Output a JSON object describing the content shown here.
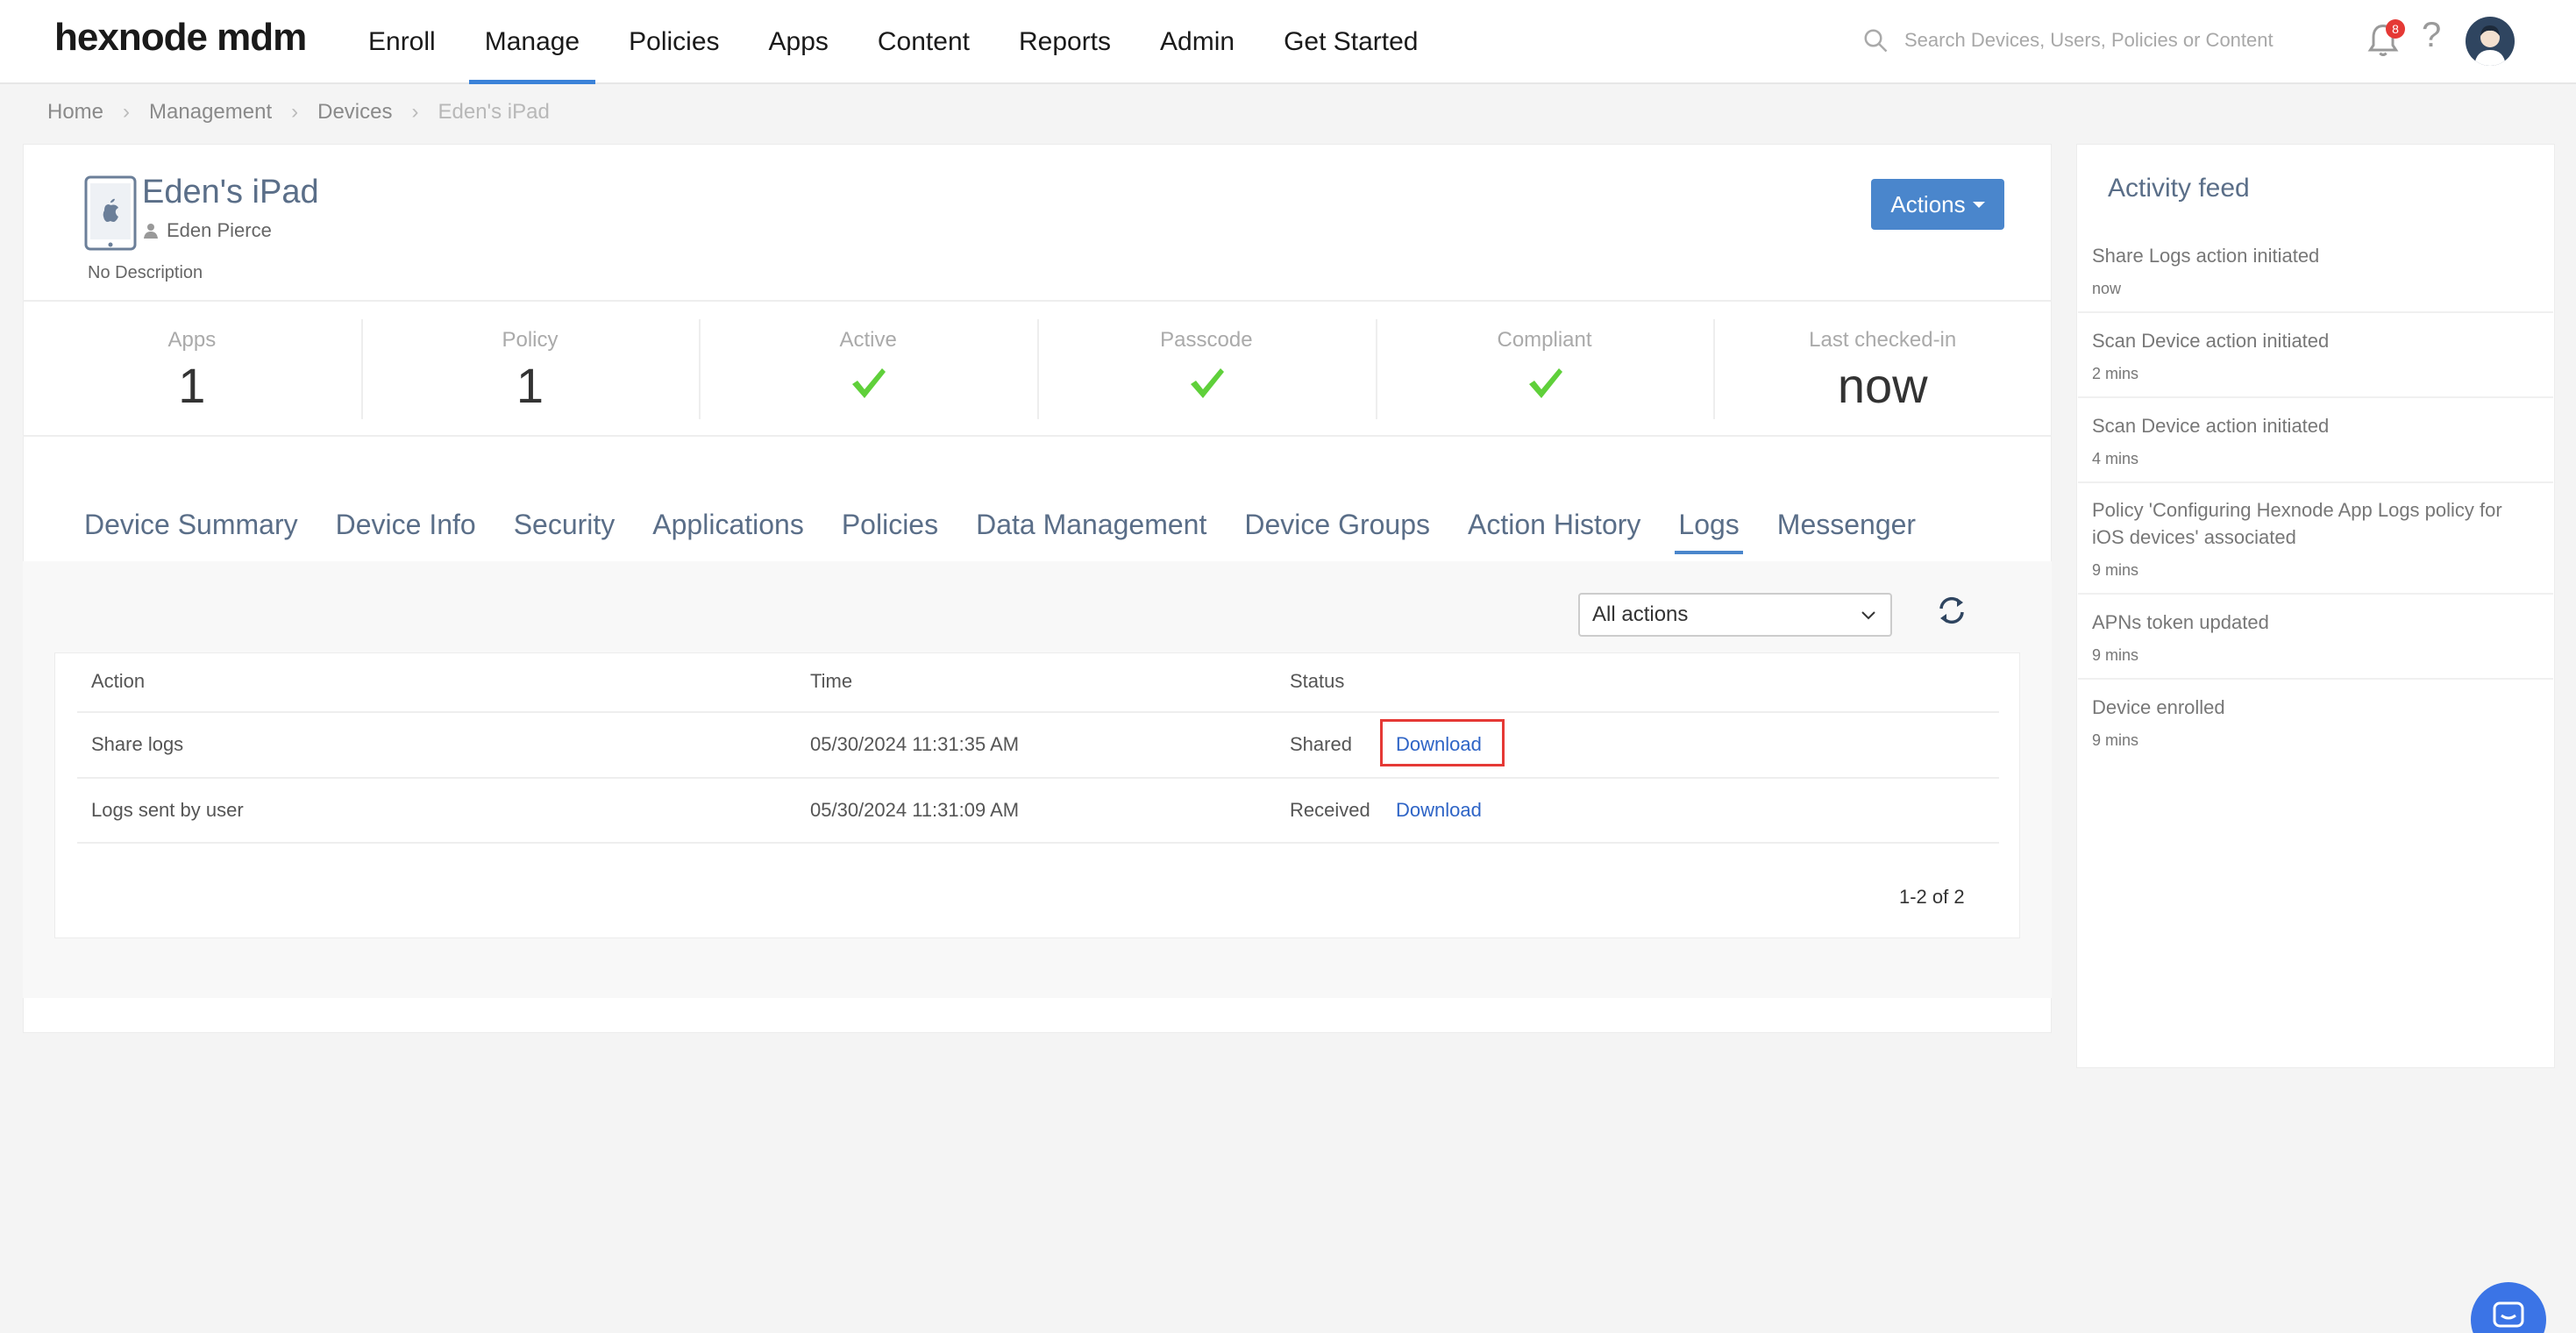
{
  "brand": {
    "logo": "hexnode mdm"
  },
  "nav": {
    "items": [
      "Enroll",
      "Manage",
      "Policies",
      "Apps",
      "Content",
      "Reports",
      "Admin",
      "Get Started"
    ],
    "active": "Manage"
  },
  "search": {
    "placeholder": "Search Devices, Users, Policies or Content"
  },
  "notifications": {
    "count": "8"
  },
  "help": {
    "label": "?"
  },
  "breadcrumb": [
    "Home",
    "Management",
    "Devices",
    "Eden's iPad"
  ],
  "device": {
    "name": "Eden's iPad",
    "user": "Eden Pierce",
    "description": "No Description",
    "actions_label": "Actions"
  },
  "stats": [
    {
      "label": "Apps",
      "value": "1"
    },
    {
      "label": "Policy",
      "value": "1"
    },
    {
      "label": "Active",
      "value": ""
    },
    {
      "label": "Passcode",
      "value": ""
    },
    {
      "label": "Compliant",
      "value": ""
    },
    {
      "label": "Last checked-in",
      "value": "now"
    }
  ],
  "tabs": [
    "Device Summary",
    "Device Info",
    "Security",
    "Applications",
    "Policies",
    "Data Management",
    "Device Groups",
    "Action History",
    "Logs",
    "Messenger"
  ],
  "active_tab": "Logs",
  "logs": {
    "filter_value": "All actions",
    "columns": {
      "action": "Action",
      "time": "Time",
      "status": "Status"
    },
    "rows": [
      {
        "action": "Share logs",
        "time": "05/30/2024   11:31:35 AM",
        "status": "Shared",
        "link": "Download"
      },
      {
        "action": "Logs sent by user",
        "time": "05/30/2024   11:31:09 AM",
        "status": "Received",
        "link": "Download"
      }
    ],
    "pagination": "1-2 of 2"
  },
  "activity_feed": {
    "title": "Activity feed",
    "items": [
      {
        "title": "Share Logs action initiated",
        "time": "now"
      },
      {
        "title": "Scan Device action initiated",
        "time": "2 mins"
      },
      {
        "title": "Scan Device action initiated",
        "time": "4 mins"
      },
      {
        "title": "Policy 'Configuring Hexnode App Logs policy for iOS devices' associated",
        "time": "9 mins"
      },
      {
        "title": "APNs token updated",
        "time": "9 mins"
      },
      {
        "title": "Device enrolled",
        "time": "9 mins"
      }
    ]
  },
  "colors": {
    "accent": "#4a86cc",
    "link": "#2e64c6",
    "check": "#5fd03a",
    "highlight": "#e53935"
  }
}
